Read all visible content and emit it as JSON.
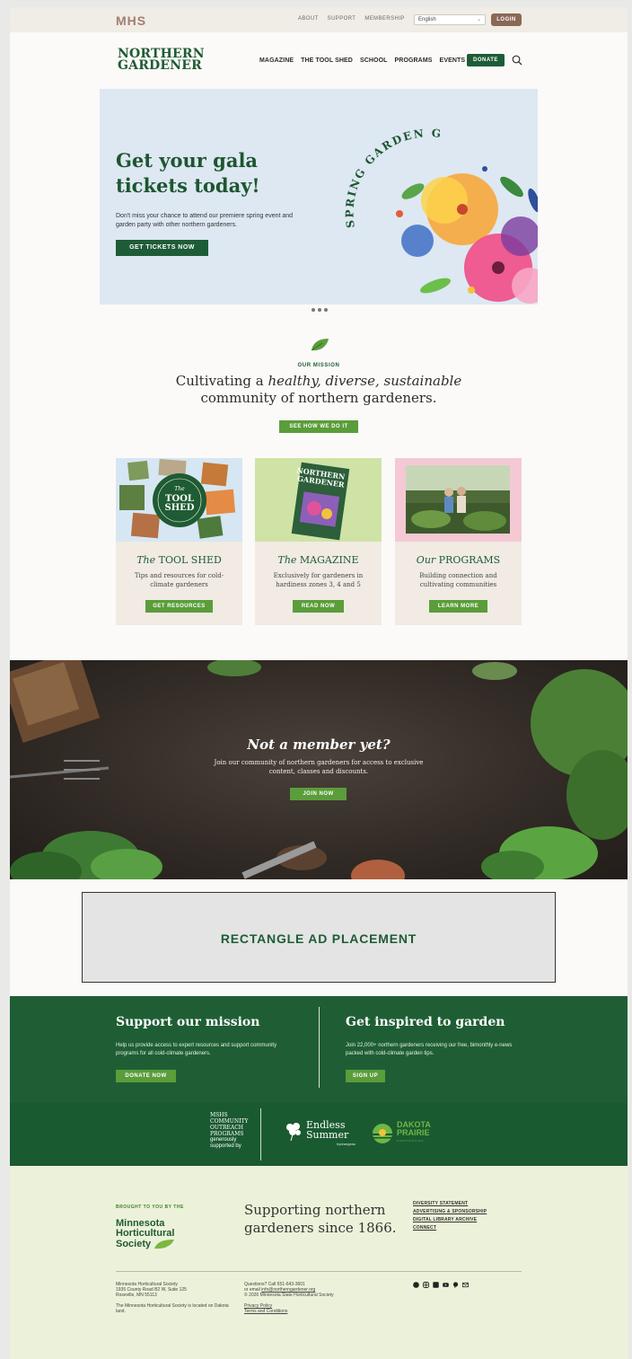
{
  "utility": {
    "logo": "MHS",
    "links": [
      "ABOUT",
      "SUPPORT",
      "MEMBERSHIP"
    ],
    "language": "English",
    "login": "LOGIN"
  },
  "brand": {
    "line1": "NORTHERN",
    "line2": "GARDENER"
  },
  "nav": {
    "items": [
      "MAGAZINE",
      "THE TOOL SHED",
      "SCHOOL",
      "PROGRAMS",
      "EVENTS"
    ],
    "donate": "DONATE"
  },
  "hero": {
    "title_line1": "Get your gala",
    "title_line2": "tickets today!",
    "body": "Don't miss your chance to attend our premiere spring event and garden party with other northern gardeners.",
    "cta": "GET TICKETS NOW",
    "art_text": "SPRING GARDEN GALA"
  },
  "mission": {
    "eyebrow": "OUR MISSION",
    "line1_prefix": "Cultivating a ",
    "line1_em": "healthy, diverse, sustainable",
    "line2": "community of northern gardeners.",
    "cta": "SEE HOW WE DO IT"
  },
  "cards": [
    {
      "title_em": "The",
      "title": " TOOL SHED",
      "body": "Tips and resources for cold-climate gardeners",
      "cta": "GET RESOURCES",
      "img_badge1": "TOOL",
      "img_badge2": "SHED",
      "img_badge_top": "The"
    },
    {
      "title_em": "The",
      "title": " MAGAZINE",
      "body": "Exclusively for gardeners in hardiness zones 3, 4 and 5",
      "cta": "READ NOW",
      "img_title1": "NORTHERN",
      "img_title2": "GARDENER"
    },
    {
      "title_em": "Our",
      "title": " PROGRAMS",
      "body": "Building connection and cultivating communities",
      "cta": "LEARN MORE"
    }
  ],
  "member": {
    "title": "Not a member yet?",
    "body": "Join our community of northern gardeners for access to exclusive content, classes and discounts.",
    "cta": "JOIN NOW"
  },
  "ad": {
    "label": "RECTANGLE AD PLACEMENT"
  },
  "support": {
    "left_title": "Support our mission",
    "left_body": "Help us provide access to expert resources and support community programs for all cold-climate gardeners.",
    "left_cta": "DONATE NOW",
    "right_title": "Get inspired to garden",
    "right_body": "Join 22,000+ northern gardeners receiving our free, bimonthly e-news packed with cold-climate garden tips.",
    "right_cta": "SIGN UP"
  },
  "sponsors": {
    "mshs_lines": [
      "MSHS",
      "COMMUNITY",
      "OUTREACH",
      "PROGRAMS"
    ],
    "mshs_sub1": "generously",
    "mshs_sub2": "supported by",
    "endless_1": "Endless",
    "endless_2": "Summer",
    "endless_sub": "hydrangeas",
    "dakota_1": "DAKOTA",
    "dakota_2": "PRAIRIE",
    "dakota_sub": "COMPOSTING"
  },
  "footer": {
    "brought": "BROUGHT TO YOU BY THE",
    "mhs_1": "Minnesota",
    "mhs_2": "Horticultural",
    "mhs_3": "Society",
    "tag_1": "Supporting northern",
    "tag_2": "gardeners since 1866.",
    "links": [
      "DIVERSITY STATEMENT",
      "ADVERTISING & SPONSORSHIP",
      "DIGITAL LIBRARY ARCHIVE",
      "CONNECT"
    ],
    "addr_1": "Minnesota Horticultural Society",
    "addr_2": "1935 County Road B2 W, Suite 125",
    "addr_3": "Roseville, MN 55113",
    "land": "The Minnesota Horticultural Society is located on Dakota land.",
    "questions": "Questions? Call 651-643-3601",
    "email_prefix": "or email ",
    "email": "info@northerngardener.org",
    "copyright": "© 2026 Minnesota State Horticultural Society",
    "privacy": "Privacy Policy",
    "terms": "Terms and Conditions"
  },
  "colors": {
    "brand_green": "#1e5c37",
    "accent_green": "#5a9d3a",
    "login_brown": "#8b6756"
  }
}
